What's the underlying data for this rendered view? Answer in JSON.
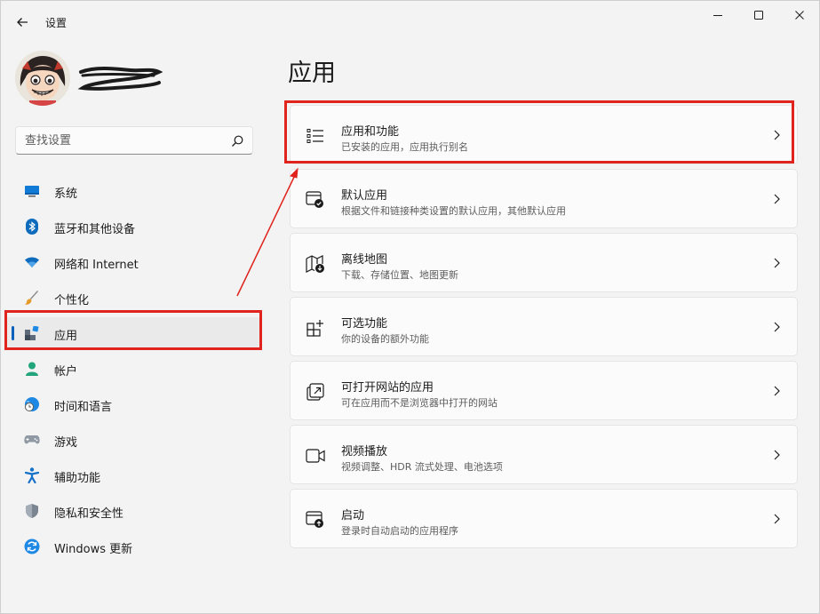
{
  "window": {
    "title": "设置",
    "colors": {
      "accent": "#005fb8",
      "annotation": "#e0231c",
      "background": "#f3f3f3"
    }
  },
  "search": {
    "placeholder": "查找设置"
  },
  "sidebar": {
    "items": [
      {
        "label": "系统",
        "icon": "monitor-icon"
      },
      {
        "label": "蓝牙和其他设备",
        "icon": "bluetooth-icon"
      },
      {
        "label": "网络和 Internet",
        "icon": "wifi-icon"
      },
      {
        "label": "个性化",
        "icon": "brush-icon"
      },
      {
        "label": "应用",
        "icon": "apps-icon",
        "selected": true
      },
      {
        "label": "帐户",
        "icon": "person-icon"
      },
      {
        "label": "时间和语言",
        "icon": "globe-clock-icon"
      },
      {
        "label": "游戏",
        "icon": "gamepad-icon"
      },
      {
        "label": "辅助功能",
        "icon": "accessibility-icon"
      },
      {
        "label": "隐私和安全性",
        "icon": "shield-icon"
      },
      {
        "label": "Windows 更新",
        "icon": "update-icon"
      }
    ]
  },
  "main": {
    "title": "应用",
    "cards": [
      {
        "title": "应用和功能",
        "subtitle": "已安装的应用，应用执行别名",
        "icon": "list-icon"
      },
      {
        "title": "默认应用",
        "subtitle": "根据文件和链接种类设置的默认应用，其他默认应用",
        "icon": "default-apps-icon"
      },
      {
        "title": "离线地图",
        "subtitle": "下载、存储位置、地图更新",
        "icon": "map-download-icon"
      },
      {
        "title": "可选功能",
        "subtitle": "你的设备的额外功能",
        "icon": "add-feature-icon"
      },
      {
        "title": "可打开网站的应用",
        "subtitle": "可在应用而不是浏览器中打开的网站",
        "icon": "open-link-icon"
      },
      {
        "title": "视频播放",
        "subtitle": "视频调整、HDR 流式处理、电池选项",
        "icon": "video-icon"
      },
      {
        "title": "启动",
        "subtitle": "登录时自动启动的应用程序",
        "icon": "startup-icon"
      }
    ]
  }
}
